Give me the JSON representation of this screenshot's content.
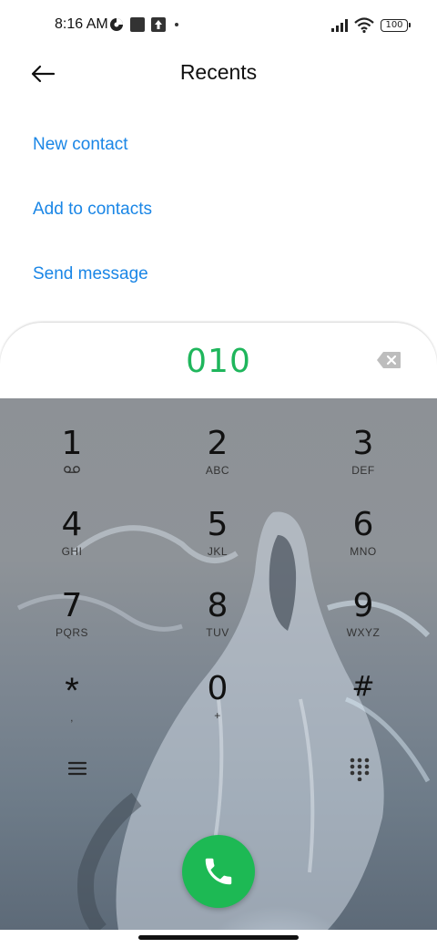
{
  "status_bar": {
    "time": "8:16 AM",
    "icons": [
      "data-saver-icon",
      "square-notification-icon",
      "upload-notification-icon",
      "more-dot-icon",
      "signal-icon",
      "wifi-icon"
    ],
    "battery": "100"
  },
  "header": {
    "back_icon": "arrow-left-icon",
    "title": "Recents"
  },
  "actions": {
    "new_contact": "New contact",
    "add_to_contacts": "Add to contacts",
    "send_message": "Send message"
  },
  "dialer": {
    "number": "010",
    "number_color": "#1fb65c",
    "backspace_icon": "backspace-icon"
  },
  "keypad": {
    "keys": [
      {
        "digit": "1",
        "letters": "",
        "icon": "voicemail-icon"
      },
      {
        "digit": "2",
        "letters": "ABC"
      },
      {
        "digit": "3",
        "letters": "DEF"
      },
      {
        "digit": "4",
        "letters": "GHI"
      },
      {
        "digit": "5",
        "letters": "JKL"
      },
      {
        "digit": "6",
        "letters": "MNO"
      },
      {
        "digit": "7",
        "letters": "PQRS"
      },
      {
        "digit": "8",
        "letters": "TUV"
      },
      {
        "digit": "9",
        "letters": "WXYZ"
      },
      {
        "digit": "*",
        "letters": ","
      },
      {
        "digit": "0",
        "letters": "+"
      },
      {
        "digit": "#",
        "letters": ""
      }
    ],
    "menu_icon": "menu-lines-icon",
    "dialpad_icon": "dialpad-icon"
  },
  "call": {
    "icon": "phone-icon",
    "color": "#1db954"
  },
  "accent_color": "#1a86e6"
}
